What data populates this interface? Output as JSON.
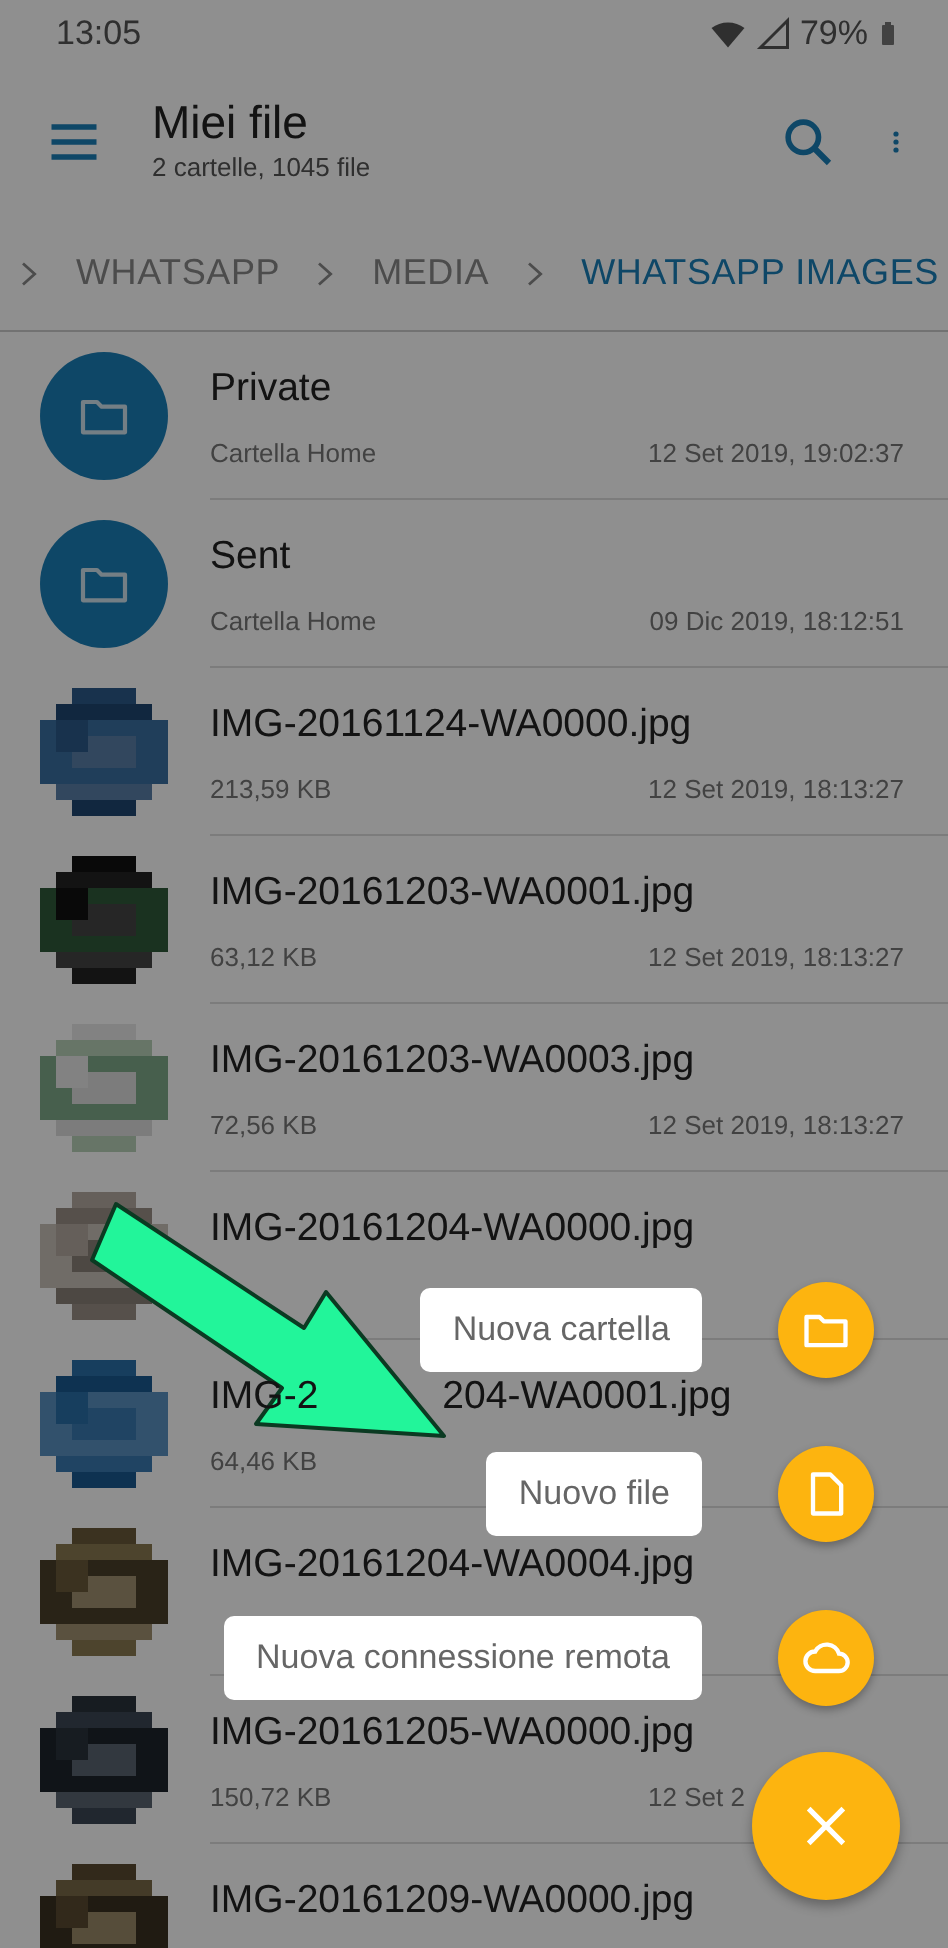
{
  "status_bar": {
    "time": "13:05",
    "battery": "79%"
  },
  "toolbar": {
    "title": "Miei file",
    "subtitle": "2 cartelle, 1045 file"
  },
  "breadcrumbs": [
    {
      "label": "WHATSAPP",
      "selected": false
    },
    {
      "label": "MEDIA",
      "selected": false
    },
    {
      "label": "WHATSAPP IMAGES",
      "selected": true
    }
  ],
  "items": [
    {
      "kind": "folder",
      "name": "Private",
      "detail": "Cartella Home",
      "date": "12 Set 2019, 19:02:37"
    },
    {
      "kind": "folder",
      "name": "Sent",
      "detail": "Cartella Home",
      "date": "09 Dic 2019, 18:12:51"
    },
    {
      "name": "IMG-20161124-WA0000.jpg",
      "detail": "213,59 KB",
      "date": "12 Set 2019, 18:13:27"
    },
    {
      "name": "IMG-20161203-WA0001.jpg",
      "detail": "63,12 KB",
      "date": "12 Set 2019, 18:13:27"
    },
    {
      "name": "IMG-20161203-WA0003.jpg",
      "detail": "72,56 KB",
      "date": "12 Set 2019, 18:13:27"
    },
    {
      "name": "IMG-20161204-WA0000.jpg"
    },
    {
      "name": "IMG-2",
      "name_after_arrow": "204-WA0001.jpg",
      "detail": "64,46 KB"
    },
    {
      "name": "IMG-20161204-WA0004.jpg"
    },
    {
      "name": "IMG-20161205-WA0000.jpg",
      "detail": "150,72 KB",
      "date": "12 Set 2"
    },
    {
      "name": "IMG-20161209-WA0000.jpg"
    }
  ],
  "fab_menu": {
    "open": true,
    "actions": [
      {
        "kind": "folder",
        "label": "Nuova cartella"
      },
      {
        "kind": "file",
        "label": "Nuovo file"
      },
      {
        "kind": "cloud",
        "label": "Nuova connessione remota"
      }
    ]
  }
}
